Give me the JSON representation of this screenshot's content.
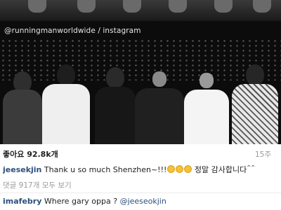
{
  "post": {
    "watermark": "@runningmanworldwide / instagram",
    "likes_label": "좋아요 92.8k개",
    "timestamp": "15주",
    "caption": {
      "username": "jeesekjin",
      "text_before_emoji": " Thank u so much Shenzhen~!!!",
      "text_after_emoji": " 정말 감사합니다",
      "suffix": "^^",
      "emoji_count": 3
    },
    "view_comments_label": "댓글 917개 모두 보기",
    "comments": [
      {
        "username": "imafebry",
        "text": " Where gary oppa ? ",
        "mention": "@jeeseokjin"
      }
    ]
  },
  "colors": {
    "username": "#2d4f7a",
    "muted": "#9a9a9a",
    "text": "#1f1f1f",
    "emoji": "#f4c23a"
  }
}
